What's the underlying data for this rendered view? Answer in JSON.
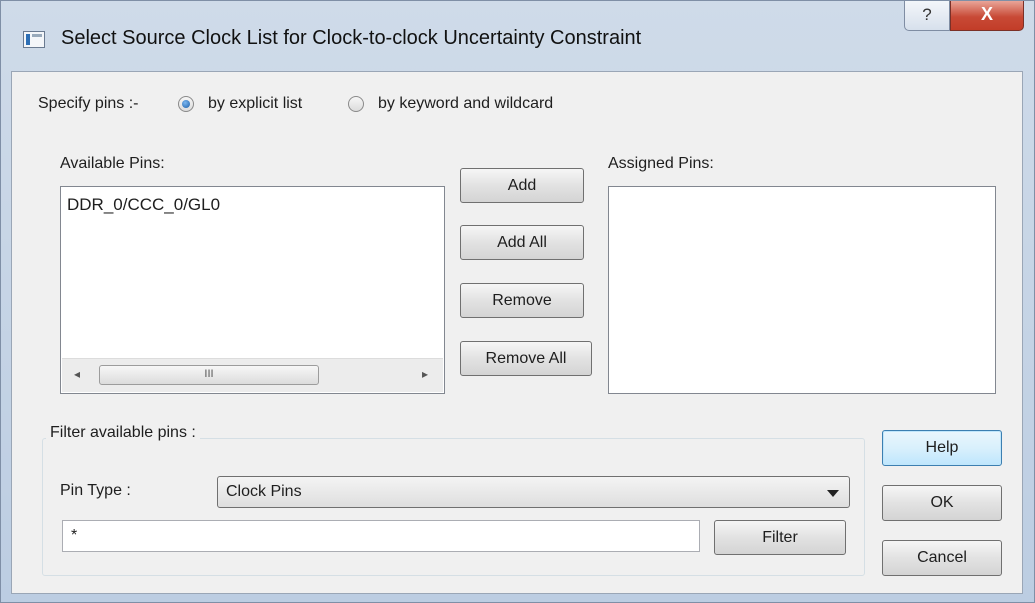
{
  "window": {
    "title": "Select Source Clock List for Clock-to-clock Uncertainty Constraint",
    "help_glyph": "?",
    "close_glyph": "X"
  },
  "specify": {
    "label": "Specify pins :-",
    "options": [
      {
        "label": "by explicit list",
        "selected": true
      },
      {
        "label": "by keyword and wildcard",
        "selected": false
      }
    ]
  },
  "available": {
    "label": "Available Pins:",
    "items": [
      "DDR_0/CCC_0/GL0"
    ],
    "scroll_left": "◂",
    "scroll_right": "▸",
    "thumb_grip": "III"
  },
  "assigned": {
    "label": "Assigned Pins:",
    "items": []
  },
  "transfer_buttons": {
    "add": "Add",
    "add_all": "Add All",
    "remove": "Remove",
    "remove_all": "Remove All"
  },
  "filter": {
    "group_label": "Filter available pins :",
    "pin_type_label": "Pin Type :",
    "pin_type_value": "Clock Pins",
    "pattern_value": "*",
    "filter_button": "Filter"
  },
  "dialog_buttons": {
    "help": "Help",
    "ok": "OK",
    "cancel": "Cancel"
  },
  "colors": {
    "close_button": "#c84a36",
    "default_button_border": "#3c7fb1",
    "radio_selected": "#1d5fa8"
  }
}
